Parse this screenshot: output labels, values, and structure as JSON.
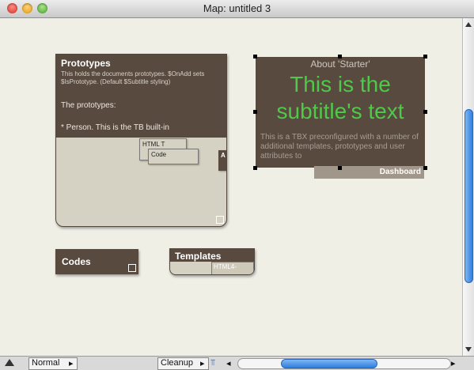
{
  "window": {
    "title": "Map: untitled 3"
  },
  "notes": {
    "prototypes": {
      "name": "Prototypes",
      "description": "This holds the documents prototypes. $OnAdd sets $IsPrototype. (Default $Subtitle styling)",
      "text1": "The prototypes:",
      "text2": "* Person. This is the TB built-in",
      "mini_html": "HTML T",
      "mini_code": "Code",
      "edge_label": "A"
    },
    "about": {
      "title": "About 'Starter'",
      "subtitle": "This is the subtitle's text",
      "body": "This is a TBX preconfigured with a number of additional templates, prototypes and user attributes to"
    },
    "dashboard": {
      "label": "Dashboard"
    },
    "codes": {
      "name": "Codes"
    },
    "templates": {
      "name": "Templates",
      "mini": "HTML4-"
    }
  },
  "bottom": {
    "view_mode": "Normal",
    "cleanup": "Cleanup"
  }
}
